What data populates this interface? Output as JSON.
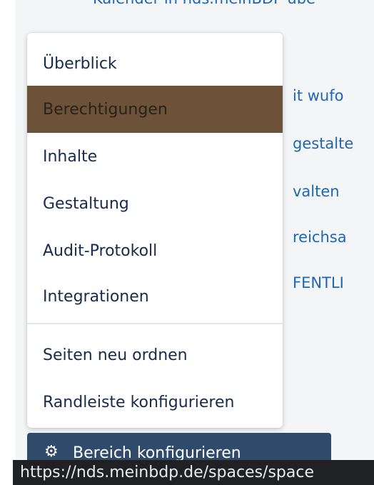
{
  "background": {
    "top_text": "Kalender in nds.meinBDP übe",
    "links": [
      "it wufo",
      "gestalte",
      "valten",
      "reichsa",
      "FENTLI"
    ]
  },
  "menu": {
    "items": [
      {
        "label": "Überblick"
      },
      {
        "label": "Berechtigungen",
        "active": true
      },
      {
        "label": "Inhalte"
      },
      {
        "label": "Gestaltung"
      },
      {
        "label": "Audit-Protokoll"
      },
      {
        "label": "Integrationen"
      }
    ],
    "secondary_items": [
      {
        "label": "Seiten neu ordnen"
      },
      {
        "label": "Randleiste konfigurieren"
      }
    ]
  },
  "config_button": {
    "label": "Bereich konfigurieren",
    "icon": "gear-icon"
  },
  "statusbar": {
    "url": "https://nds.meinbdp.de/spaces/space"
  },
  "colors": {
    "active_item_bg": "#6b5239",
    "link": "#1f66b3",
    "button_bg": "#2f4a6b",
    "statusbar_bg": "#202124"
  }
}
